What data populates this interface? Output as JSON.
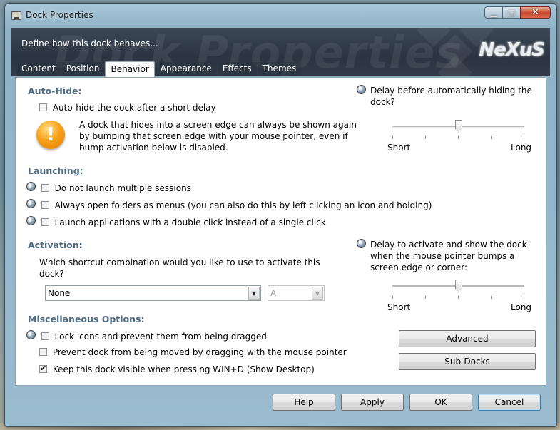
{
  "window": {
    "title": "Dock Properties"
  },
  "banner": {
    "subtitle": "Define how this dock behaves...",
    "watermark": "Dock Properties",
    "logo": "NeXuS"
  },
  "tabs": [
    {
      "label": "Content",
      "active": false
    },
    {
      "label": "Position",
      "active": false
    },
    {
      "label": "Behavior",
      "active": true
    },
    {
      "label": "Appearance",
      "active": false
    },
    {
      "label": "Effects",
      "active": false
    },
    {
      "label": "Themes",
      "active": false
    }
  ],
  "autohide": {
    "heading": "Auto-Hide:",
    "checkbox_label": "Auto-hide the dock after a short delay",
    "checked": false,
    "info_line1": "A dock that hides into a screen edge can always be shown again",
    "info_line2": "by bumping that screen edge with your mouse pointer, even if",
    "info_line3": "bump activation below is disabled.",
    "delay_label_line1": "Delay before automatically hiding the",
    "delay_label_line2": "dock?",
    "slider_min_label": "Short",
    "slider_max_label": "Long",
    "slider_value": 0.5
  },
  "launching": {
    "heading": "Launching:",
    "options": [
      {
        "label": "Do not launch multiple sessions",
        "checked": false
      },
      {
        "label": "Always open folders as menus (you can also do this by left clicking an icon and holding)",
        "checked": false
      },
      {
        "label": "Launch applications with a double click instead of a single click",
        "checked": false
      }
    ]
  },
  "activation": {
    "heading": "Activation:",
    "question_line1": "Which shortcut combination would you like to use to activate this",
    "question_line2": "dock?",
    "combo_value": "None",
    "key_value": "A",
    "delay_label_line1": "Delay to activate and show the dock",
    "delay_label_line2": "when the mouse pointer bumps a",
    "delay_label_line3": "screen edge or corner:",
    "slider_min_label": "Short",
    "slider_max_label": "Long",
    "slider_value": 0.5
  },
  "misc": {
    "heading": "Miscellaneous Options:",
    "options": [
      {
        "label": "Lock icons and prevent them from being dragged",
        "checked": false
      },
      {
        "label": "Prevent dock from being moved by dragging with the mouse pointer",
        "checked": false
      },
      {
        "label": "Keep this dock visible when pressing WIN+D (Show Desktop)",
        "checked": true
      }
    ],
    "advanced_button": "Advanced",
    "subdocks_button": "Sub-Docks"
  },
  "footer": {
    "help": "Help",
    "apply": "Apply",
    "ok": "OK",
    "cancel": "Cancel"
  }
}
